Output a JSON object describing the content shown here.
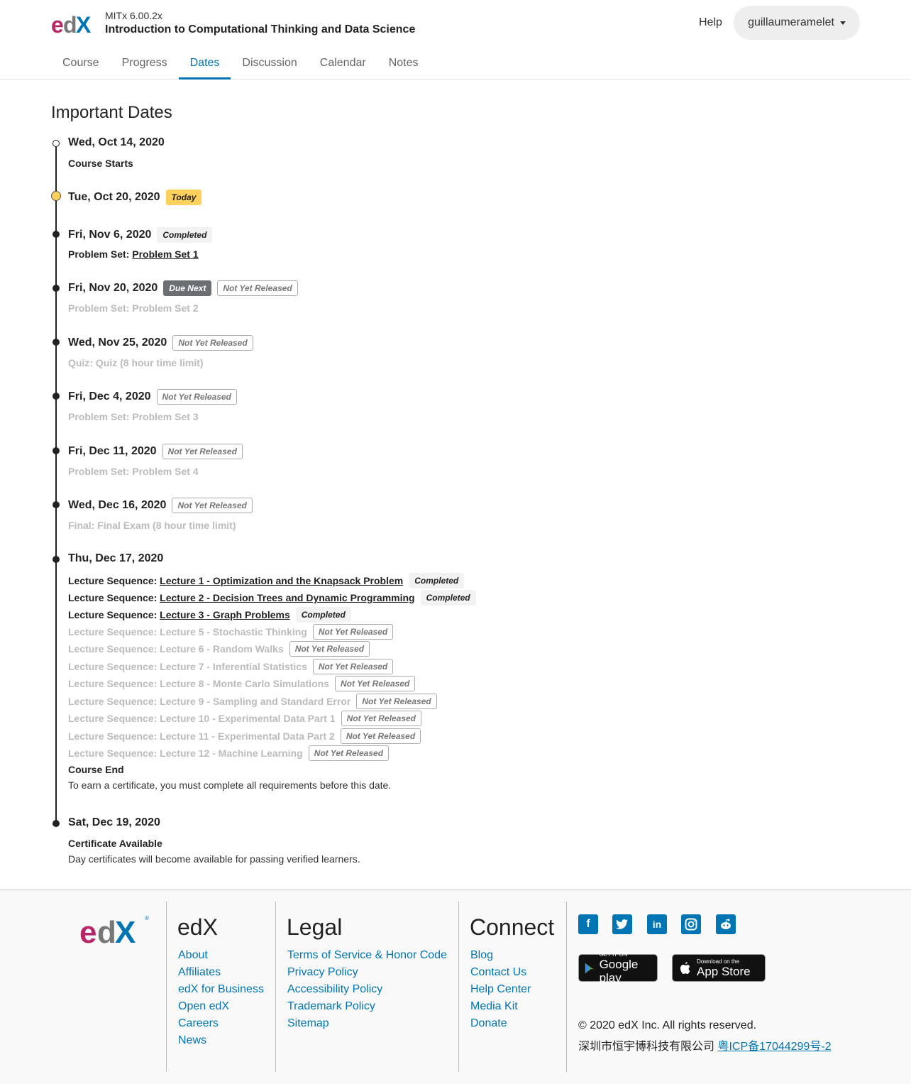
{
  "header": {
    "course_org": "MITx 6.00.2x",
    "course_title": "Introduction to Computational Thinking and Data Science",
    "help_label": "Help",
    "username": "guillaumeramelet"
  },
  "tabs": [
    {
      "label": "Course"
    },
    {
      "label": "Progress"
    },
    {
      "label": "Dates",
      "active": true
    },
    {
      "label": "Discussion"
    },
    {
      "label": "Calendar"
    },
    {
      "label": "Notes"
    }
  ],
  "page_title": "Important Dates",
  "timeline": {
    "e1": {
      "date": "Wed, Oct 14, 2020",
      "title": "Course Starts"
    },
    "e2": {
      "date": "Tue, Oct 20, 2020",
      "badge": "Today"
    },
    "e3": {
      "date": "Fri, Nov 6, 2020",
      "badge": "Completed",
      "prefix": "Problem Set:",
      "link": "Problem Set 1"
    },
    "e4": {
      "date": "Fri, Nov 20, 2020",
      "badge1": "Due Next",
      "badge2": "Not Yet Released",
      "text": "Problem Set: Problem Set 2"
    },
    "e5": {
      "date": "Wed, Nov 25, 2020",
      "badge": "Not Yet Released",
      "text": "Quiz: Quiz (8 hour time limit)"
    },
    "e6": {
      "date": "Fri, Dec 4, 2020",
      "badge": "Not Yet Released",
      "text": "Problem Set: Problem Set 3"
    },
    "e7": {
      "date": "Fri, Dec 11, 2020",
      "badge": "Not Yet Released",
      "text": "Problem Set: Problem Set 4"
    },
    "e8": {
      "date": "Wed, Dec 16, 2020",
      "badge": "Not Yet Released",
      "text": "Final: Final Exam (8 hour time limit)"
    },
    "e9": {
      "date": "Thu, Dec 17, 2020",
      "prefix": "Lecture Sequence:",
      "completed_badge": "Completed",
      "nyr_badge": "Not Yet Released",
      "l1": "Lecture 1 - Optimization and the Knapsack Problem",
      "l2": "Lecture 2 - Decision Trees and Dynamic Programming",
      "l3": "Lecture 3 - Graph Problems",
      "l5": "Lecture Sequence: Lecture 5 - Stochastic Thinking",
      "l6": "Lecture Sequence: Lecture 6 - Random Walks",
      "l7": "Lecture Sequence: Lecture 7 - Inferential Statistics",
      "l8": "Lecture Sequence: Lecture 8 - Monte Carlo Simulations",
      "l9": "Lecture Sequence: Lecture 9 - Sampling and Standard Error",
      "l10": "Lecture Sequence: Lecture 10 - Experimental Data Part 1",
      "l11": "Lecture Sequence: Lecture 11 - Experimental Data Part 2",
      "l12": "Lecture Sequence: Lecture 12 - Machine Learning",
      "end_title": "Course End",
      "end_desc": "To earn a certificate, you must complete all requirements before this date."
    },
    "e10": {
      "date": "Sat, Dec 19, 2020",
      "title": "Certificate Available",
      "desc": "Day certificates will become available for passing verified learners."
    }
  },
  "footer": {
    "edx_title": "edX",
    "edx_links": [
      "About",
      "Affiliates",
      "edX for Business",
      "Open edX",
      "Careers",
      "News"
    ],
    "legal_title": "Legal",
    "legal_links": [
      "Terms of Service & Honor Code",
      "Privacy Policy",
      "Accessibility Policy",
      "Trademark Policy",
      "Sitemap"
    ],
    "connect_title": "Connect",
    "connect_links": [
      "Blog",
      "Contact Us",
      "Help Center",
      "Media Kit",
      "Donate"
    ],
    "google_small": "GET IT ON",
    "google_large": "Google play",
    "apple_small": "Download on the",
    "apple_large": "App Store",
    "copyright": "© 2020 edX Inc. All rights reserved.",
    "icp_text": "深圳市恒宇博科技有限公司",
    "icp_link": "粤ICP备17044299号-2"
  }
}
